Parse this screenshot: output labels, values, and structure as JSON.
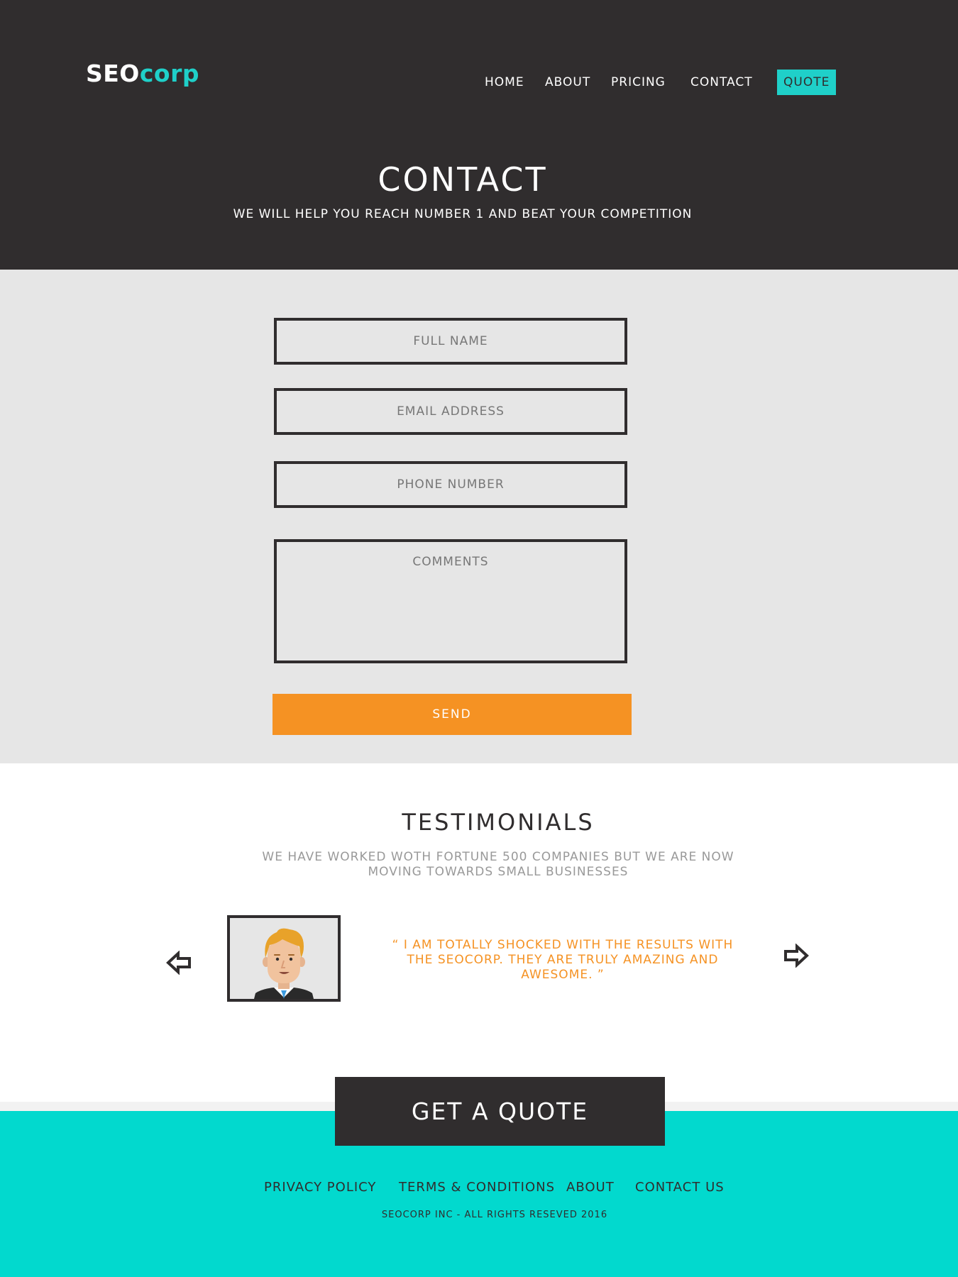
{
  "brand": {
    "logo_primary": "SEO",
    "logo_accent": "corp",
    "accent_color": "#1fd0c9",
    "dark_color": "#302d2e",
    "orange_color": "#f59223",
    "footer_color": "#02d9ce"
  },
  "nav": {
    "home": "HOME",
    "about": "ABOUT",
    "pricing": "PRICING",
    "contact": "CONTACT",
    "quote": "QUOTE"
  },
  "hero": {
    "title": "CONTACT",
    "subtitle": "WE WILL HELP YOU REACH NUMBER 1 AND BEAT YOUR COMPETITION"
  },
  "form": {
    "full_name_placeholder": "FULL NAME",
    "email_placeholder": "EMAIL ADDRESS",
    "phone_placeholder": "PHONE NUMBER",
    "comments_placeholder": "COMMENTS",
    "send_label": "SEND"
  },
  "testimonials": {
    "title": "TESTIMONIALS",
    "subtitle": "WE HAVE WORKED WOTH FORTUNE 500 COMPANIES BUT WE ARE NOW MOVING TOWARDS SMALL BUSINESSES",
    "quote": "“ I AM TOTALLY SHOCKED WITH THE RESULTS WITH THE SEOCORP. THEY ARE TRULY AMAZING AND AWESOME. ”",
    "prev_icon": "arrow-left-icon",
    "next_icon": "arrow-right-icon"
  },
  "cta": {
    "label": "GET A QUOTE"
  },
  "footer": {
    "privacy": "PRIVACY POLICY",
    "terms": "TERMS & CONDITIONS",
    "about": "ABOUT",
    "contact_us": "CONTACT US",
    "copyright": "SEOCORP INC -  ALL RIGHTS RESEVED 2016"
  }
}
